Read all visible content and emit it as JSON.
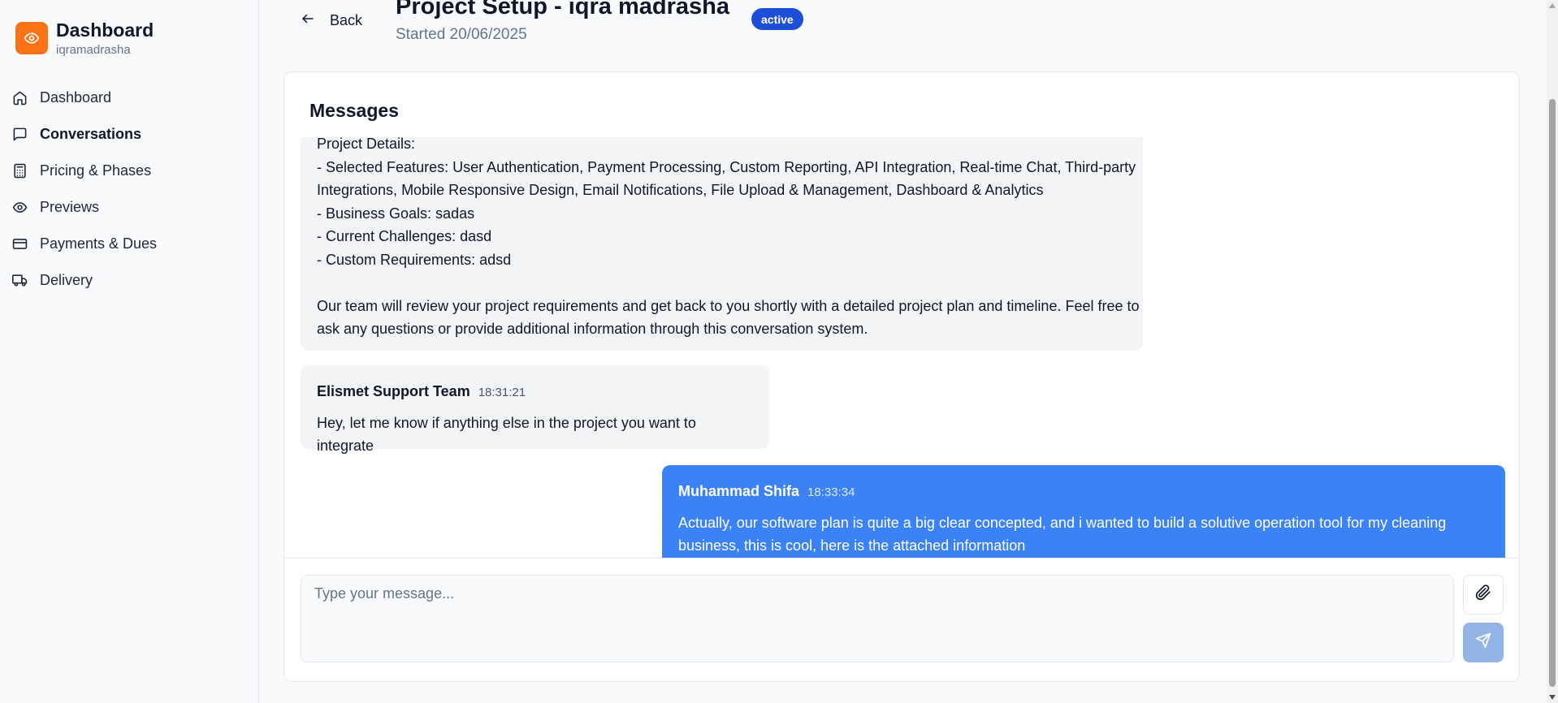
{
  "sidebar": {
    "brand_title": "Dashboard",
    "brand_subtitle": "iqramadrasha",
    "items": [
      {
        "label": "Dashboard",
        "icon": "home-icon"
      },
      {
        "label": "Conversations",
        "icon": "message-square-icon",
        "active": true
      },
      {
        "label": "Pricing & Phases",
        "icon": "calculator-icon"
      },
      {
        "label": "Previews",
        "icon": "eye-icon"
      },
      {
        "label": "Payments & Dues",
        "icon": "credit-card-icon"
      },
      {
        "label": "Delivery",
        "icon": "truck-icon"
      }
    ]
  },
  "header": {
    "back_label": "Back",
    "title": "Project Setup - iqra madrasha",
    "status": "active",
    "started": "Started 20/06/2025"
  },
  "messages_card": {
    "title": "Messages",
    "messages": [
      {
        "lines": [
          "Project Details:",
          "- Selected Features: User Authentication, Payment Processing, Custom Reporting, API Integration, Real-time Chat, Third-party",
          "Integrations, Mobile Responsive Design, Email Notifications, File Upload & Management, Dashboard & Analytics",
          "- Business Goals: sadas",
          "- Current Challenges: dasd",
          "- Custom Requirements: adsd"
        ],
        "closing_1": "Our team will review your project requirements and get back to you shortly with a detailed project plan and timeline. Feel free to",
        "closing_2": "ask any questions or provide additional information through this conversation system."
      },
      {
        "sender": "Elismet Support Team",
        "time": "18:31:21",
        "text": "Hey, let me know if anything else in the project you want to integrate"
      },
      {
        "sender": "Muhammad Shifa",
        "time": "18:33:34",
        "text_1": "Actually, our software plan is quite a big clear concepted, and i wanted to build a solutive operation tool for my cleaning",
        "text_2": "business, this is cool, here is the attached information"
      }
    ]
  },
  "composer": {
    "placeholder": "Type your message...",
    "value": ""
  },
  "colors": {
    "brand": "#f97316",
    "badge": "#1d4ed8",
    "own_message": "#3b82f6",
    "send_button": "#93b4e6"
  }
}
